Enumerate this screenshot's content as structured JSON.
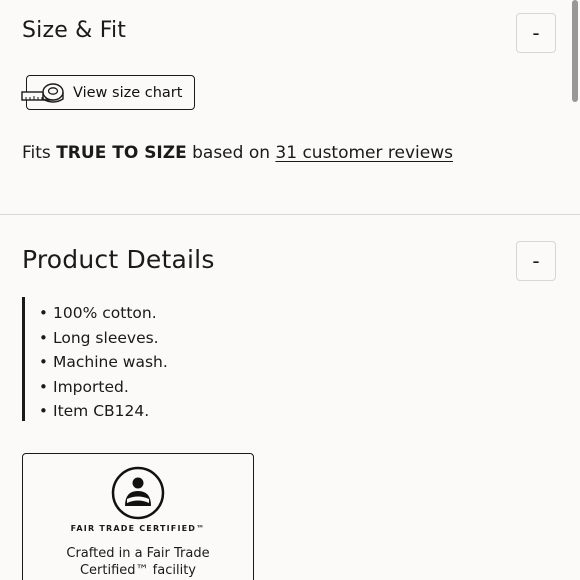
{
  "size_fit": {
    "title": "Size & Fit",
    "toggle_label": "-",
    "size_chart_label": "View size chart",
    "fit_prefix": "Fits ",
    "fit_value": "TRUE TO SIZE",
    "fit_middle": " based on ",
    "reviews_link": "31 customer reviews"
  },
  "product_details": {
    "title": "Product Details",
    "toggle_label": "-",
    "items": [
      "100% cotton.",
      "Long sleeves.",
      "Machine wash.",
      "Imported.",
      "Item CB124."
    ]
  },
  "fair_trade": {
    "badge_text": "FAIR TRADE CERTIFIED™",
    "caption_line1": "Crafted in a Fair Trade",
    "caption_line2": "Certified™ facility",
    "logo_icon": "fair-trade-certified-logo"
  },
  "icons": {
    "size_chart_icon": "tape-measure-icon"
  }
}
